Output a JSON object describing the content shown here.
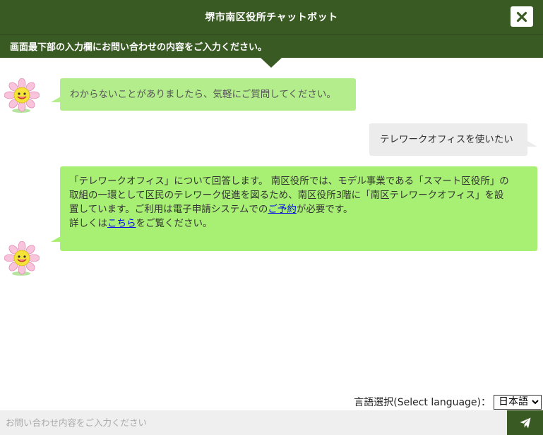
{
  "header": {
    "title": "堺市南区役所チャットボット",
    "close_icon": "close-icon"
  },
  "notice": {
    "text": "画面最下部の入力欄にお問い合わせの内容をご入力ください。"
  },
  "messages": [
    {
      "sender": "bot",
      "text": "わからないことがありましたら、気軽にご質問してください。"
    },
    {
      "sender": "user",
      "text": "テレワークオフィスを使いたい"
    },
    {
      "sender": "bot",
      "line1": "「テレワークオフィス」について回答します。 南区役所では、モデル事業である「スマート区役所」の",
      "line2": "取組の一環として区民のテレワーク促進を図るため、南区役所3階に「南区テレワークオフィス」を設",
      "line3_pre": "置しています。ご利用は電子申請システムでの",
      "line3_link": "ご予約",
      "line3_post": "が必要です。",
      "line4_pre": "詳しくは",
      "line4_link": "こちら",
      "line4_post": "をご覧ください。"
    }
  ],
  "bot_avatar_icon": "flower-mascot-icon",
  "language": {
    "label": "言語選択(Select language)：",
    "selected": "日本語"
  },
  "input": {
    "placeholder": "お問い合わせ内容をご入力ください",
    "value": ""
  },
  "send_icon": "paper-plane-icon",
  "colors": {
    "header_bg": "#3a5a24",
    "bot_bubble": "#a8f074",
    "user_bubble": "#ececec"
  }
}
